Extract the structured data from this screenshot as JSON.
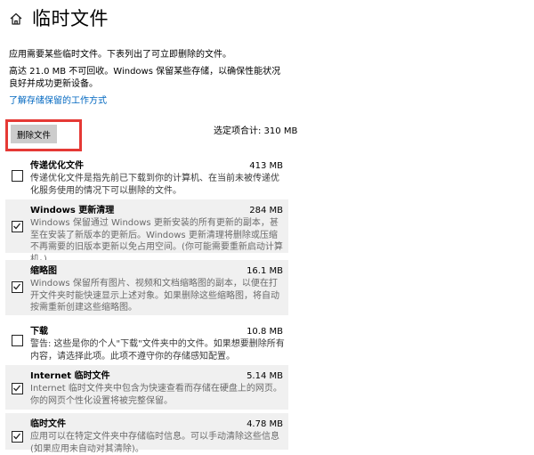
{
  "header": {
    "home_icon": "home-icon",
    "title": "临时文件"
  },
  "description": {
    "line1": "应用需要某些临时文件。下表列出了可立即删除的文件。",
    "line2": "高达 21.0 MB 不可回收。Windows 保留某些存储，以确保性能状况良好并成功更新设备。",
    "link": "了解存储保留的工作方式"
  },
  "actions": {
    "delete_label": "删除文件",
    "selected_total": "选定项合计: 310 MB"
  },
  "items": [
    {
      "name": "传递优化文件",
      "size": "413 MB",
      "checked": false,
      "description": "传递优化文件是指先前已下载到你的计算机、在当前未被传递优化服务使用的情况下可以删除的文件。"
    },
    {
      "name": "Windows 更新清理",
      "size": "284 MB",
      "checked": true,
      "description": "Windows 保留通过 Windows 更新安装的所有更新的副本，甚至在安装了新版本的更新后。Windows 更新清理将删除或压缩不再需要的旧版本更新以免占用空间。(你可能需要重新启动计算机。)"
    },
    {
      "name": "缩略图",
      "size": "16.1 MB",
      "checked": true,
      "description": "Windows 保留所有图片、视频和文档缩略图的副本，以便在打开文件夹时能快速显示上述对象。如果删除这些缩略图，将自动按需重新创建这些缩略图。"
    },
    {
      "name": "下载",
      "size": "10.8 MB",
      "checked": false,
      "description": "警告: 这些是你的个人\"下载\"文件夹中的文件。如果想要删除所有内容，请选择此项。此项不遵守你的存储感知配置。"
    },
    {
      "name": "Internet 临时文件",
      "size": "5.14 MB",
      "checked": true,
      "description": "Internet 临时文件夹中包含为快速查看而存储在硬盘上的网页。你的网页个性化设置将被完整保留。"
    },
    {
      "name": "临时文件",
      "size": "4.78 MB",
      "checked": true,
      "description": "应用可以在特定文件夹中存储临时信息。可以手动清除这些信息(如果应用未自动对其清除)。"
    }
  ]
}
